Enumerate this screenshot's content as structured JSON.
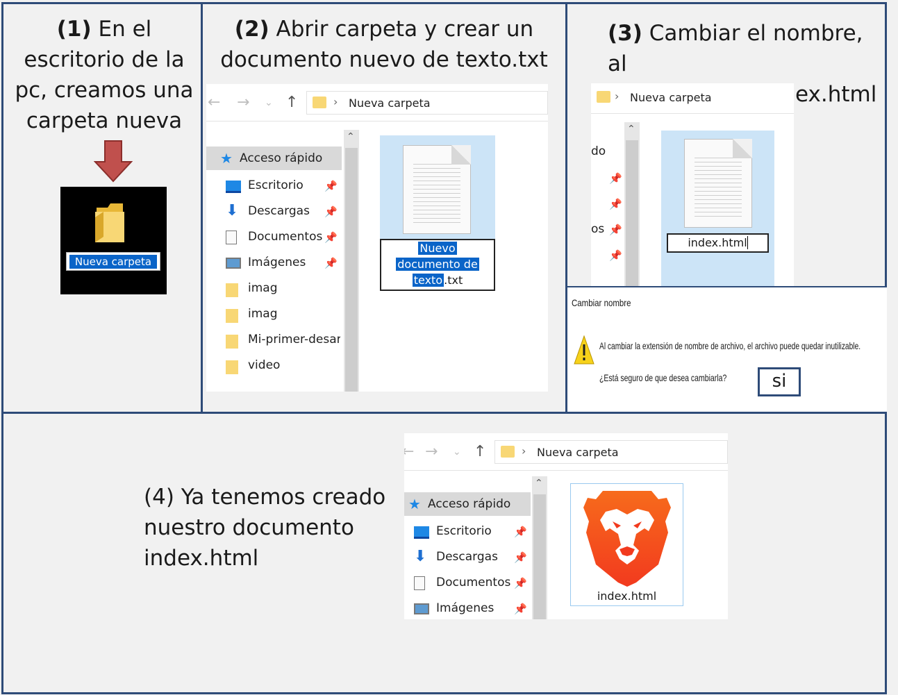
{
  "step1": {
    "num": "(1)",
    "text_a": " En el",
    "text_b": "escritorio de la",
    "text_c": "pc, creamos una",
    "text_d": "carpeta nueva",
    "folder_label": "Nueva carpeta"
  },
  "step2": {
    "num": "(2)",
    "text_a": " Abrir carpeta y crear un",
    "text_b": "documento nuevo de texto.txt",
    "address": "Nueva carpeta",
    "sidebar": [
      {
        "label": "Acceso rápido",
        "icon": "star-icon"
      },
      {
        "label": "Escritorio",
        "icon": "desktop-icon"
      },
      {
        "label": "Descargas",
        "icon": "download-icon"
      },
      {
        "label": "Documentos",
        "icon": "document-icon"
      },
      {
        "label": "Imágenes",
        "icon": "image-icon"
      },
      {
        "label": "imag",
        "icon": "folder-icon"
      },
      {
        "label": "imag",
        "icon": "folder-icon"
      },
      {
        "label": "Mi-primer-desar",
        "icon": "folder-icon"
      },
      {
        "label": "video",
        "icon": "folder-icon"
      }
    ],
    "file_name_1": "Nuevo",
    "file_name_2": "documento de",
    "file_name_3": "texto",
    "file_ext": ".txt"
  },
  "step3": {
    "num": "(3)",
    "text_a": " Cambiar el nombre, al",
    "text_b": "documento a index.html",
    "address": "Nueva carpeta",
    "side_fragment_1": "do",
    "side_fragment_2": "os",
    "file_name": "index.html",
    "dialog_title": "Cambiar nombre",
    "dialog_message": "Al cambiar la extensión de nombre de archivo, el archivo puede quedar inutilizable.",
    "dialog_question": "¿Está seguro de que desea cambiarla?",
    "dialog_button": "si"
  },
  "step4": {
    "text_a": "(4) Ya tenemos creado",
    "text_b": "nuestro documento",
    "text_c": "index.html",
    "address": "Nueva carpeta",
    "sidebar": [
      {
        "label": "Acceso rápido",
        "icon": "star-icon"
      },
      {
        "label": "Escritorio",
        "icon": "desktop-icon"
      },
      {
        "label": "Descargas",
        "icon": "download-icon"
      },
      {
        "label": "Documentos",
        "icon": "document-icon"
      },
      {
        "label": "Imágenes",
        "icon": "image-icon"
      }
    ],
    "file_name": "index.html"
  },
  "colors": {
    "border": "#2e4b78",
    "selection": "#0a64c8",
    "tile_selected": "#cce4f7",
    "brave_orange": "#f4541d",
    "arrow_red": "#c0504d"
  }
}
